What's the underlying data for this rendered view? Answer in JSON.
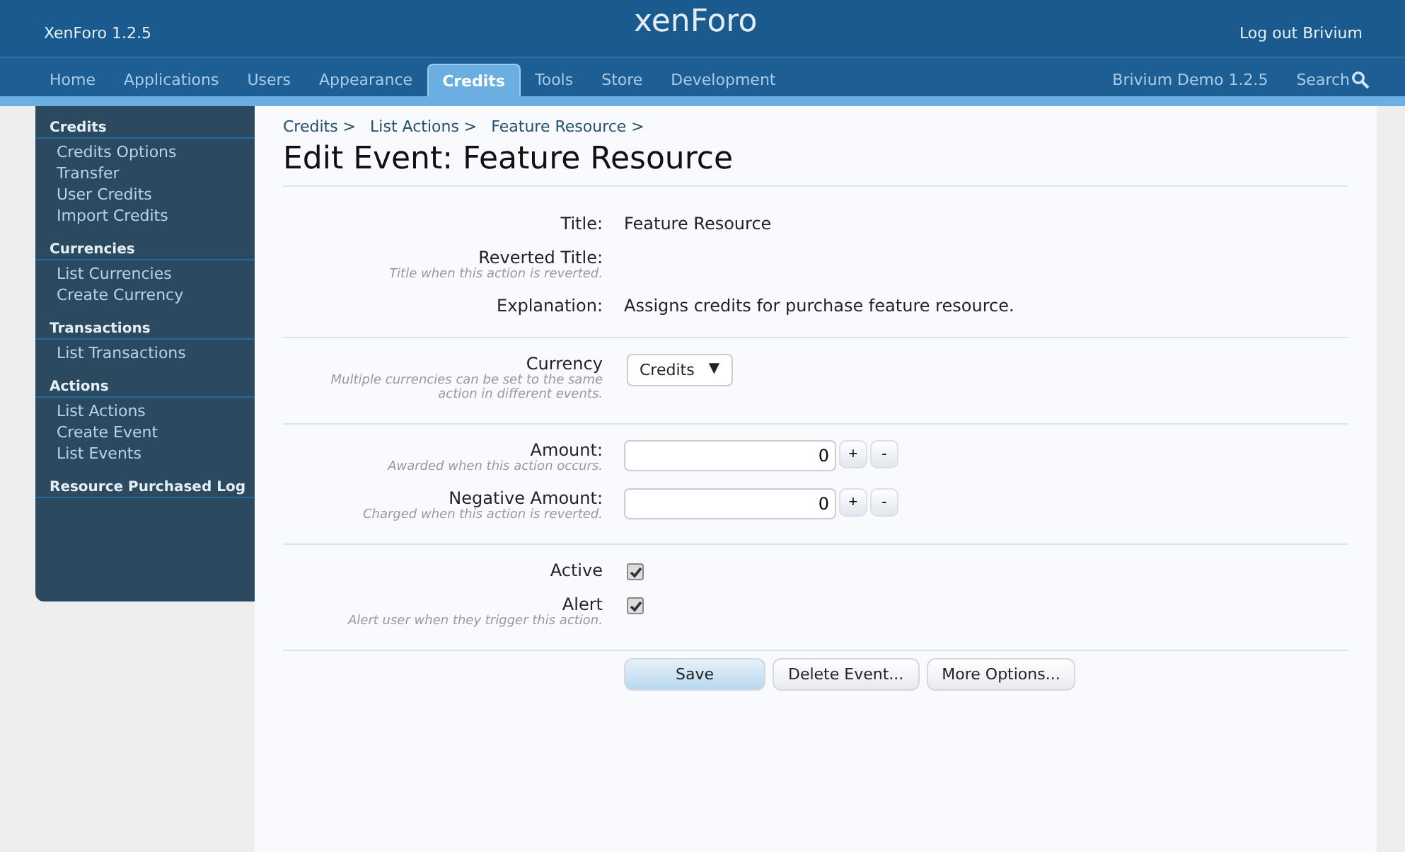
{
  "header": {
    "version": "XenForo 1.2.5",
    "logo": "xenForo",
    "logout": "Log out Brivium"
  },
  "tabs": [
    {
      "label": "Home",
      "selected": false
    },
    {
      "label": "Applications",
      "selected": false
    },
    {
      "label": "Users",
      "selected": false
    },
    {
      "label": "Appearance",
      "selected": false
    },
    {
      "label": "Credits",
      "selected": true
    },
    {
      "label": "Tools",
      "selected": false
    },
    {
      "label": "Store",
      "selected": false
    },
    {
      "label": "Development",
      "selected": false
    }
  ],
  "nav_right": {
    "board": "Brivium Demo 1.2.5",
    "search": "Search"
  },
  "sidebar": {
    "groups": [
      {
        "heading": "Credits",
        "items": [
          "Credits Options",
          "Transfer",
          "User Credits",
          "Import Credits"
        ]
      },
      {
        "heading": "Currencies",
        "items": [
          "List Currencies",
          "Create Currency"
        ]
      },
      {
        "heading": "Transactions",
        "items": [
          "List Transactions"
        ]
      },
      {
        "heading": "Actions",
        "items": [
          "List Actions",
          "Create Event",
          "List Events"
        ]
      },
      {
        "heading": "Resource Purchased Log"
      }
    ]
  },
  "breadcrumbs": [
    "Credits >",
    "List Actions >",
    "Feature Resource >"
  ],
  "title": "Edit Event: Feature Resource",
  "sections": [
    {
      "rows": [
        {
          "kind": "text",
          "label": "Title:",
          "value": "Feature Resource"
        },
        {
          "kind": "text",
          "label": "Reverted Title:",
          "hint": "Title when this action is reverted."
        },
        {
          "kind": "text",
          "label": "Explanation:",
          "value": "Assigns credits for purchase feature resource."
        }
      ]
    },
    {
      "rows": [
        {
          "kind": "select",
          "label": "Currency",
          "hint": "Multiple currencies can be set to the same action in different events.",
          "value": "Credits",
          "caret": "▼"
        }
      ]
    },
    {
      "rows": [
        {
          "kind": "number",
          "label": "Amount:",
          "hint": "Awarded when this action occurs.",
          "value": "0",
          "plus": "+",
          "minus": "-"
        },
        {
          "kind": "number",
          "label": "Negative Amount:",
          "hint": "Charged when this action is reverted.",
          "value": "0",
          "plus": "+",
          "minus": "-"
        }
      ]
    },
    {
      "rows": [
        {
          "kind": "checkbox",
          "label": "Active",
          "checked": true
        },
        {
          "kind": "checkbox",
          "label": "Alert",
          "hint": "Alert user when they trigger this action.",
          "checked": true
        }
      ]
    }
  ],
  "buttons": [
    {
      "label": "Save",
      "kind": "primary"
    },
    {
      "label": "Delete Event...",
      "kind": "secondary"
    },
    {
      "label": "More Options...",
      "kind": "secondary"
    }
  ]
}
